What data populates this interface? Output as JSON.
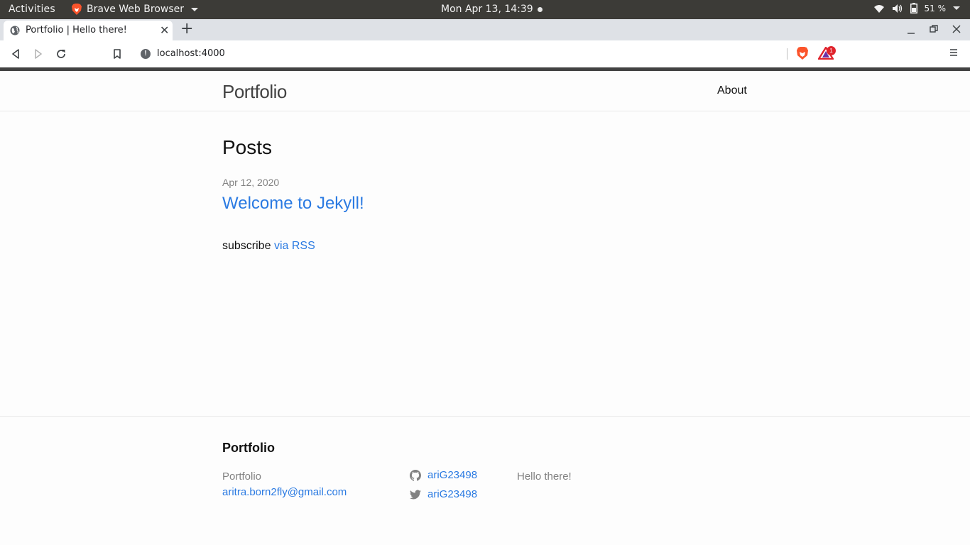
{
  "system_bar": {
    "activities": "Activities",
    "app_name": "Brave Web Browser",
    "clock": "Mon Apr 13, 14:39",
    "battery": "51 %"
  },
  "browser": {
    "tab_title": "Portfolio | Hello there!",
    "tab_close": "✕",
    "new_tab": "+",
    "url": "localhost:4000",
    "rewards_badge": "1"
  },
  "site": {
    "title": "Portfolio",
    "nav": {
      "about": "About"
    }
  },
  "main": {
    "heading": "Posts",
    "posts": [
      {
        "date": "Apr 12, 2020",
        "title": "Welcome to Jekyll!"
      }
    ],
    "rss_prefix": "subscribe",
    "rss_link": "via RSS"
  },
  "footer": {
    "heading": "Portfolio",
    "name": "Portfolio",
    "email": "aritra.born2fly@gmail.com",
    "github_user": "ariG23498",
    "twitter_user": "ariG23498",
    "description": "Hello there!"
  },
  "colors": {
    "link": "#2a7ae2",
    "meta": "#828282",
    "text": "#111111",
    "topbar": "#3c3b37"
  },
  "icons": [
    "brave-lion-icon",
    "wifi-icon",
    "volume-icon",
    "battery-icon",
    "globe-icon",
    "back-icon",
    "forward-icon",
    "reload-icon",
    "bookmark-icon",
    "info-icon",
    "brave-shields-icon",
    "brave-rewards-icon",
    "menu-icon",
    "github-icon",
    "twitter-icon"
  ]
}
